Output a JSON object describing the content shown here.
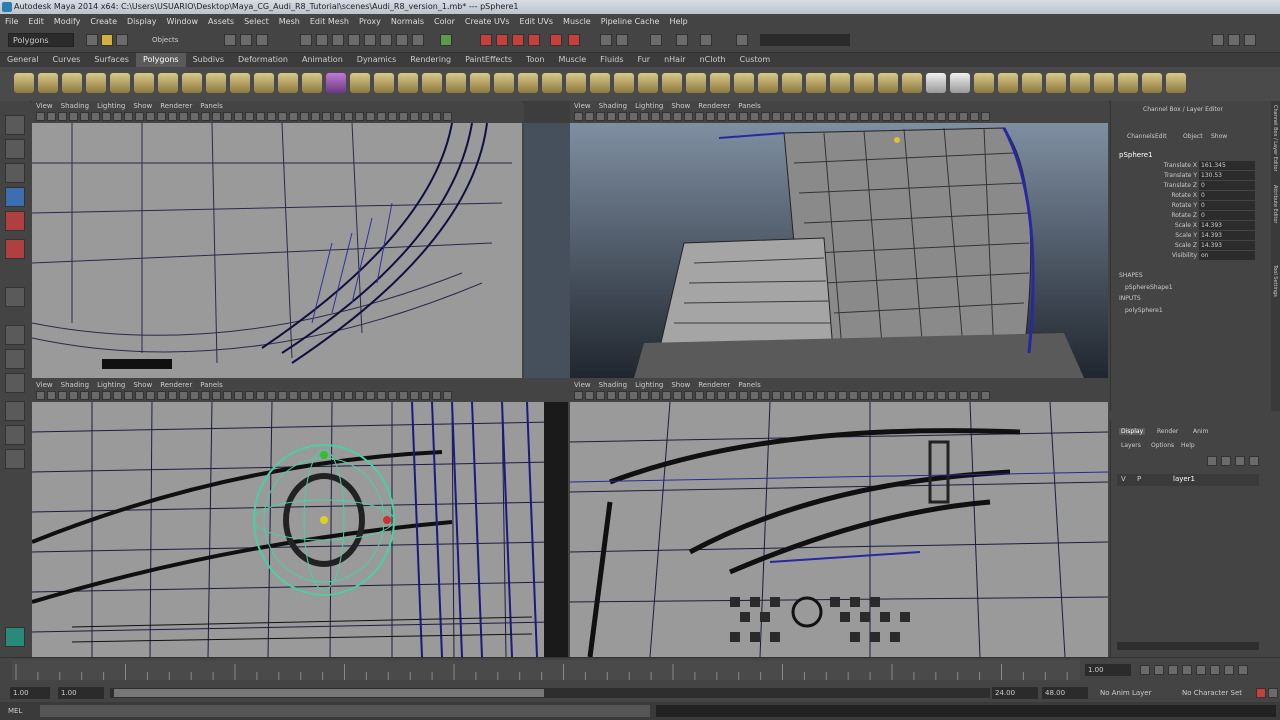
{
  "window": {
    "title": "Autodesk Maya 2014 x64: C:\\Users\\USUARIO\\Desktop\\Maya_CG_Audi_R8_Tutorial\\scenes\\Audi_R8_version_1.mb* --- pSphere1"
  },
  "menubar": {
    "items": [
      "File",
      "Edit",
      "Modify",
      "Create",
      "Display",
      "Window",
      "Assets",
      "Select",
      "Mesh",
      "Edit Mesh",
      "Proxy",
      "Normals",
      "Color",
      "Create UVs",
      "Edit UVs",
      "Muscle",
      "Pipeline Cache",
      "Help"
    ]
  },
  "statusline": {
    "menuset": "Polygons",
    "objects_label": "Objects"
  },
  "shelf": {
    "tabs": [
      "General",
      "Curves",
      "Surfaces",
      "Polygons",
      "Subdivs",
      "Deformation",
      "Animation",
      "Dynamics",
      "Rendering",
      "PaintEffects",
      "Toon",
      "Muscle",
      "Fluids",
      "Fur",
      "nHair",
      "nCloth",
      "Custom"
    ],
    "active_tab": "Polygons"
  },
  "panels": {
    "menu_items": [
      "View",
      "Shading",
      "Lighting",
      "Show",
      "Renderer",
      "Panels"
    ]
  },
  "channel_box": {
    "title": "Channel Box / Layer Editor",
    "menus": [
      "Channels",
      "Edit",
      "Object",
      "Show"
    ],
    "object_name": "pSphere1",
    "channels": [
      {
        "label": "Translate X",
        "value": "161.345"
      },
      {
        "label": "Translate Y",
        "value": "130.53"
      },
      {
        "label": "Translate Z",
        "value": "0"
      },
      {
        "label": "Rotate X",
        "value": "0"
      },
      {
        "label": "Rotate Y",
        "value": "0"
      },
      {
        "label": "Rotate Z",
        "value": "0"
      },
      {
        "label": "Scale X",
        "value": "14.393"
      },
      {
        "label": "Scale Y",
        "value": "14.393"
      },
      {
        "label": "Scale Z",
        "value": "14.393"
      },
      {
        "label": "Visibility",
        "value": "on"
      }
    ],
    "shapes_label": "SHAPES",
    "shape_name": "pSphereShape1",
    "inputs_label": "INPUTS",
    "input_name": "polySphere1"
  },
  "side_tabs": [
    "Channel Box / Layer Editor",
    "Attribute Editor",
    "Tool Settings"
  ],
  "layer_editor": {
    "tabs": [
      "Display",
      "Render",
      "Anim"
    ],
    "menus": [
      "Layers",
      "Options",
      "Help"
    ],
    "layer": {
      "v": "V",
      "p": "P",
      "name": "layer1"
    }
  },
  "time": {
    "current_frame": "1.00",
    "start": "1.00",
    "range_start": "1.00",
    "range_end": "24.00",
    "end": "48.00",
    "anim_layer": "No Anim Layer",
    "character_set": "No Character Set"
  },
  "command": {
    "label": "MEL"
  },
  "colors": {
    "accent": "#5a9a4a",
    "wire": "#1a1a6a",
    "viewport_bg": "#9a9a9a"
  }
}
